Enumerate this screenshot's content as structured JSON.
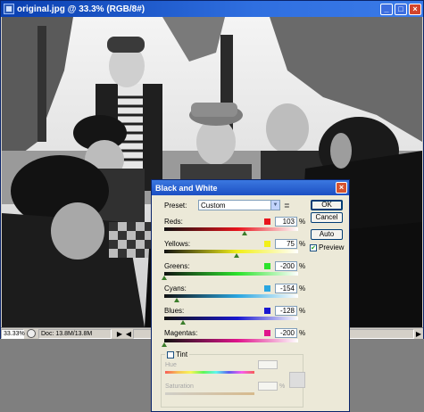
{
  "window": {
    "title": "original.jpg @ 33.3% (RGB/8#)",
    "minimize_label": "_",
    "maximize_label": "□",
    "close_label": "×"
  },
  "status": {
    "zoom": "33.33%",
    "doc_info": "Doc: 13.8M/13.8M",
    "arrow_left": "◀",
    "arrow_right": "▶"
  },
  "dialog": {
    "title": "Black and White",
    "close_label": "×",
    "preset_label": "Preset:",
    "preset_value": "Custom",
    "preset_menu_icon": "≣",
    "ok_label": "OK",
    "cancel_label": "Cancel",
    "auto_label": "Auto",
    "preview_label": "Preview",
    "preview_checked": true,
    "sliders": [
      {
        "label": "Reds:",
        "value": "103",
        "unit": "%",
        "color": "#e8141c",
        "level": 0.6
      },
      {
        "label": "Yellows:",
        "value": "75",
        "unit": "%",
        "color": "#f2ef1a",
        "level": 0.54
      },
      {
        "label": "Greens:",
        "value": "-200",
        "unit": "%",
        "color": "#2ce32c",
        "level": 0.0
      },
      {
        "label": "Cyans:",
        "value": "-154",
        "unit": "%",
        "color": "#2aa6e0",
        "level": 0.09
      },
      {
        "label": "Blues:",
        "value": "-128",
        "unit": "%",
        "color": "#1a18d0",
        "level": 0.14
      },
      {
        "label": "Magentas:",
        "value": "-200",
        "unit": "%",
        "color": "#e0148c",
        "level": 0.0
      }
    ],
    "tint": {
      "label": "Tint",
      "checked": false,
      "hue_label": "Hue",
      "saturation_label": "Saturation",
      "pct": "%"
    }
  },
  "colors": {
    "titlebar": "#0a3fb0",
    "dialog_bg": "#ece9d8"
  }
}
